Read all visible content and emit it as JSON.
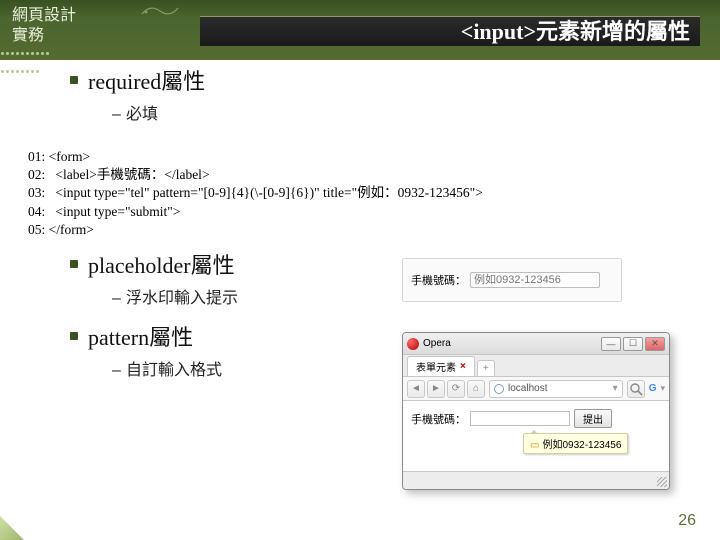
{
  "header": {
    "logo_line1": "網頁設計",
    "logo_line2": "實務",
    "title": "<input>元素新增的屬性"
  },
  "bullets": {
    "required": {
      "heading": "required屬性",
      "sub": "必填"
    },
    "placeholder": {
      "heading": "placeholder屬性",
      "sub": "浮水印輸入提示"
    },
    "pattern": {
      "heading": "pattern屬性",
      "sub": "自訂輸入格式"
    }
  },
  "code": {
    "l1": "01: <form>",
    "l2": "02:   <label>手機號碼：</label>",
    "l3": "03:   <input type=\"tel\" pattern=\"[0-9]{4}(\\-[0-9]{6})\" title=\"例如：0932-123456\">",
    "l4": "04:   <input type=\"submit\">",
    "l5": "05: </form>"
  },
  "demo1": {
    "label": "手機號碼：",
    "placeholder": "例如0932-123456"
  },
  "opera": {
    "app": "Opera",
    "tab_label": "表單元素",
    "url": "localhost",
    "form_label": "手機號碼：",
    "submit_label": "提出",
    "tooltip": "例如0932-123456"
  },
  "page_number": "26"
}
